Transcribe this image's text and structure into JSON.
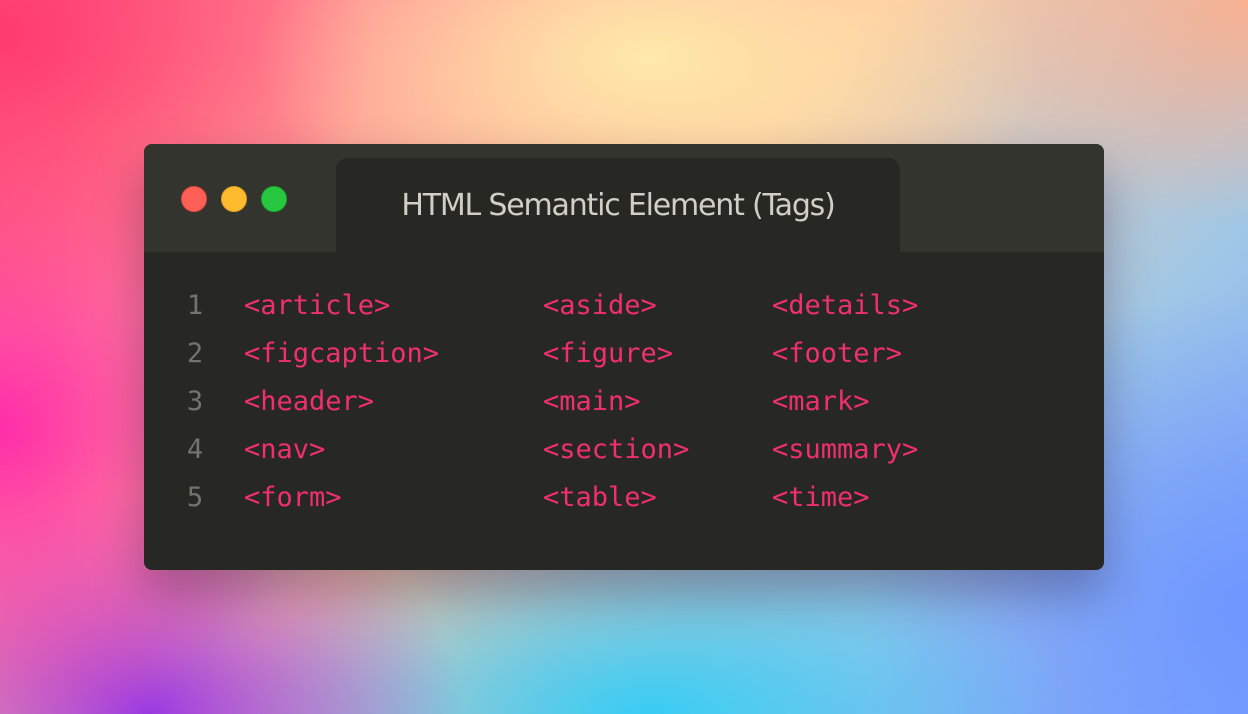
{
  "window": {
    "title": "HTML Semantic Element (Tags)",
    "controls": [
      "close",
      "minimize",
      "maximize"
    ]
  },
  "code": {
    "lines": [
      {
        "number": "1",
        "tags": [
          "<article>",
          "<aside>",
          "<details>"
        ]
      },
      {
        "number": "2",
        "tags": [
          "<figcaption>",
          "<figure>",
          "<footer>"
        ]
      },
      {
        "number": "3",
        "tags": [
          "<header>",
          "<main>",
          "<mark>"
        ]
      },
      {
        "number": "4",
        "tags": [
          "<nav>",
          "<section>",
          "<summary>"
        ]
      },
      {
        "number": "5",
        "tags": [
          "<form>",
          "<table>",
          "<time>"
        ]
      }
    ]
  },
  "colors": {
    "tag": "#f0306b",
    "line_number": "#74746e",
    "editor_bg": "#272723",
    "titlebar_bg": "#34342e",
    "title_text": "#cfcfc6",
    "close": "#fe5f57",
    "minimize": "#febb2e",
    "maximize": "#27c840"
  }
}
